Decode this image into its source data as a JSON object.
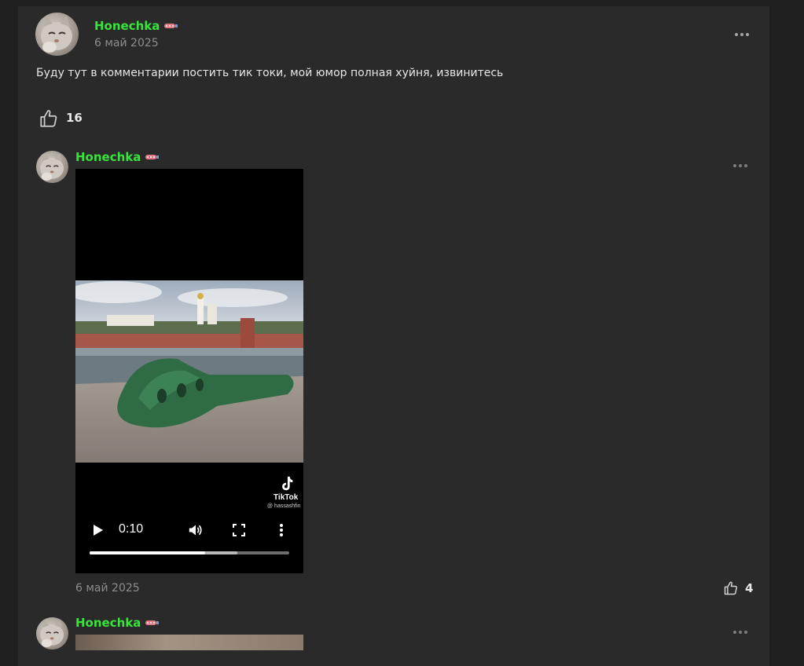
{
  "post": {
    "author": "Honechka",
    "date": "6 май 2025",
    "text": "Буду тут в комментарии постить тик токи, мой юмор полная хуйня, извинитесь",
    "likes": "16"
  },
  "comments": [
    {
      "author": "Honechka",
      "date": "6 май 2025",
      "likes": "4",
      "video": {
        "time": "0:10",
        "progress_played": 0.58,
        "progress_buffered": 0.74,
        "watermark_brand": "TikTok",
        "watermark_user": "@ hassashfin"
      }
    },
    {
      "author": "Honechka"
    }
  ],
  "icons": {
    "badge": "sausage-badge-icon",
    "more": "more-dots-icon",
    "like": "thumbs-up-icon",
    "play": "play-icon",
    "volume": "volume-icon",
    "fullscreen": "fullscreen-icon",
    "menu": "vertical-dots-icon"
  },
  "colors": {
    "username": "#39e23c",
    "background": "#2a2a2a"
  }
}
